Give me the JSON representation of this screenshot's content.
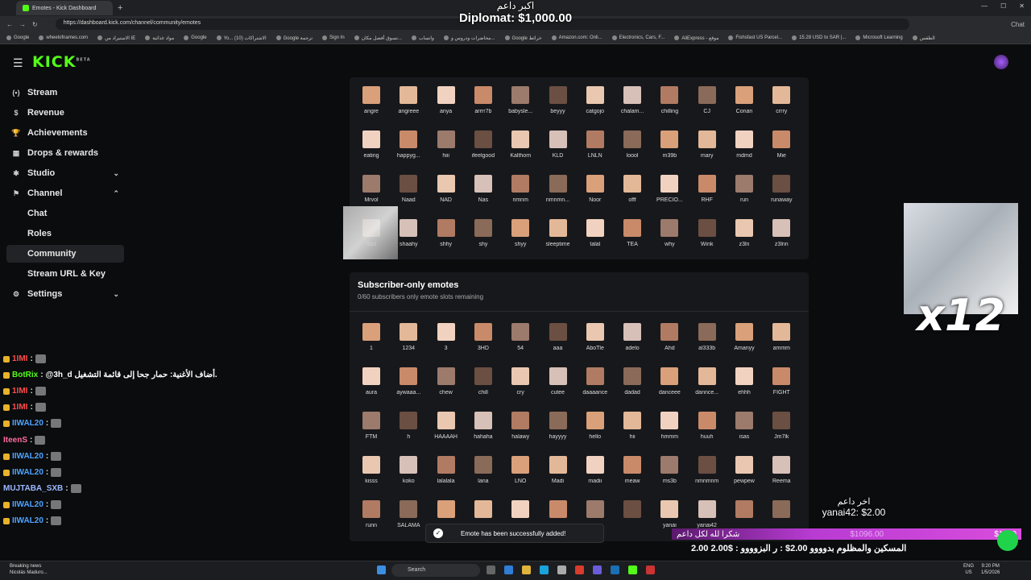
{
  "browser": {
    "tab_title": "Emotes - Kick Dashboard",
    "url": "https://dashboard.kick.com/channel/community/emotes",
    "chat_label": "Chat",
    "bookmarks": [
      "Google",
      "wheelofnames.com",
      "الاستيراد من IE",
      "مواد غذائية",
      "Google",
      "Yo... (10) الاشتراكات",
      "Google ترجمة",
      "Sign In",
      "تسوق أفضل مكان...",
      "واتساب",
      "محاضرات ودروس و...",
      "Google خرائط",
      "Amazon.com: Onli...",
      "Electronics, Cars, F...",
      "AliExpress - موقع",
      "Fishsfast US Parcel...",
      "15.28 USD to SAR |...",
      "Microsoft Learning",
      "الطقس"
    ]
  },
  "overlay": {
    "top_donation_title": "اكبر داعم",
    "top_donation_value": "Diplomat: $1,000.00",
    "last_donation_title": "اخر داعم",
    "last_donation_value": "yanai42: $2.00",
    "x12": "x12",
    "bar_left": "شكرا لله لكل داعم",
    "bar_mid": "$1096.00",
    "bar_right": "$1000",
    "ticker": "2.00  2.00$ : المسكين والمظلوم بدوووو  2.00$ : ر البزوووو"
  },
  "sidebar": {
    "logo": "KICK",
    "logo_badge": "BETA",
    "items": [
      {
        "label": "Stream",
        "icon": "stream-icon"
      },
      {
        "label": "Revenue",
        "icon": "dollar-icon"
      },
      {
        "label": "Achievements",
        "icon": "trophy-icon"
      },
      {
        "label": "Drops & rewards",
        "icon": "gift-icon"
      },
      {
        "label": "Studio",
        "icon": "studio-icon"
      },
      {
        "label": "Channel",
        "icon": "channel-icon"
      },
      {
        "label": "Chat"
      },
      {
        "label": "Roles"
      },
      {
        "label": "Community"
      },
      {
        "label": "Stream URL & Key"
      },
      {
        "label": "Settings",
        "icon": "gear-icon"
      }
    ]
  },
  "chat": [
    {
      "user": "1IMI",
      "color": "#ff4d4d",
      "msg": ""
    },
    {
      "user": "BotRix",
      "color": "#53fc18",
      "msg": "@3h_d أضاف الأغنية: حمار جحا إلى قائمة التشغيل."
    },
    {
      "user": "1IMI",
      "color": "#ff4d4d",
      "msg": ""
    },
    {
      "user": "1IMI",
      "color": "#ff4d4d",
      "msg": ""
    },
    {
      "user": "IIWAL20",
      "color": "#4fa3ff",
      "msg": ""
    },
    {
      "user": "IteenS",
      "color": "#ff6b9d",
      "msg": ""
    },
    {
      "user": "IIWAL20",
      "color": "#4fa3ff",
      "msg": ""
    },
    {
      "user": "IIWAL20",
      "color": "#4fa3ff",
      "msg": ""
    },
    {
      "user": "MUJTABA_SXB",
      "color": "#9ab8ff",
      "msg": ""
    },
    {
      "user": "IIWAL20",
      "color": "#4fa3ff",
      "msg": ""
    },
    {
      "user": "IIWAL20",
      "color": "#4fa3ff",
      "msg": ""
    }
  ],
  "channel_emotes": [
    "angre",
    "angreee",
    "anya",
    "arrrr7b",
    "babysle...",
    "beyyy",
    "catgojo",
    "chalam...",
    "chilling",
    "CJ",
    "Conan",
    "crrry",
    "eating",
    "happyg...",
    "hiii",
    "ifeelgood",
    "Kalthom",
    "KLD",
    "LNLN",
    "loool",
    "m39b",
    "mary",
    "mdmd",
    "Mie",
    "Mrvol",
    "Naad",
    "NAD",
    "Nas",
    "nmnm",
    "nmnmn...",
    "Noor",
    "offf",
    "PRECIO...",
    "RHF",
    "run",
    "runaway",
    "Sad",
    "shaahy",
    "shhy",
    "shy",
    "shyy",
    "sleeptime",
    "talal",
    "TEA",
    "why",
    "Wink",
    "z3ln",
    "z3lnn"
  ],
  "subscriber": {
    "title": "Subscriber-only emotes",
    "subtitle": "0/60 subscribers only emote slots remaining",
    "emotes": [
      "1",
      "1234",
      "3",
      "3HD",
      "54",
      "aaa",
      "AboTle",
      "adelo",
      "Ahd",
      "al333b",
      "Amanyy",
      "ammm",
      "aura",
      "aywaaa...",
      "chew",
      "chill",
      "cry",
      "cutee",
      "daaaance",
      "dadad",
      "danceee",
      "dannce...",
      "ehhh",
      "FIGHT",
      "FTM",
      "h",
      "HAAAAH",
      "hahaha",
      "halawy",
      "hayyyy",
      "hello",
      "hii",
      "hmmm",
      "huuh",
      "isas",
      "Jm7lk",
      "kisss",
      "koko",
      "lalalala",
      "lana",
      "LNO",
      "Madi",
      "madii",
      "meaw",
      "ms3b",
      "nmnmnm",
      "pewpew",
      "Reema",
      "runn",
      "SALAMA",
      "",
      "",
      "",
      "",
      "",
      "",
      "yanai",
      "yanai42",
      "",
      ""
    ]
  },
  "toast": "Emote has been successfully added!",
  "taskbar": {
    "news_title": "Breaking news",
    "news_sub": "Nicolás Maduro...",
    "search": "Search",
    "lang1": "ENG",
    "lang2": "US",
    "time": "9:20 PM",
    "date": "1/5/2026"
  }
}
